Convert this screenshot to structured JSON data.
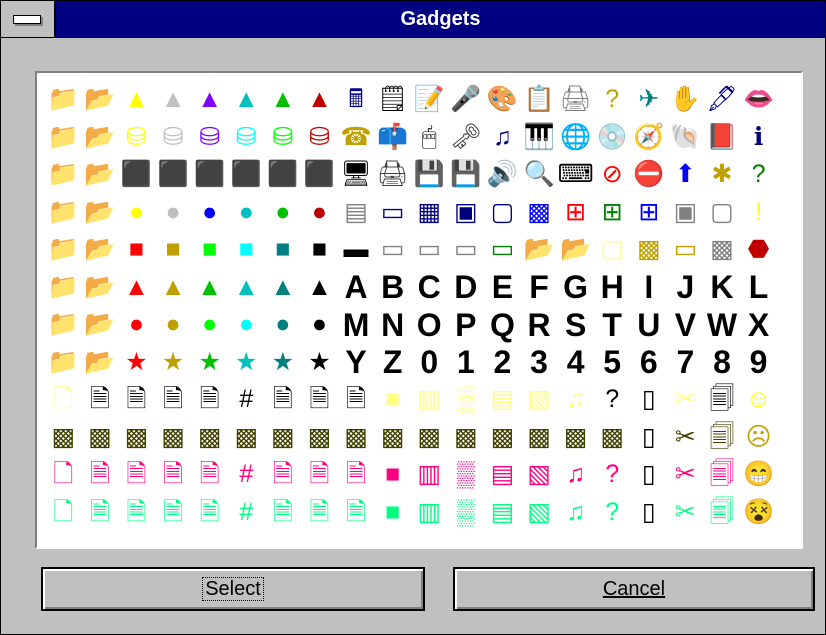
{
  "window": {
    "title": "Gadgets"
  },
  "buttons": {
    "select_label": "Select",
    "cancel_label": "Cancel"
  },
  "grid": {
    "rows": [
      [
        {
          "g": "📁",
          "c": "#e0006a"
        },
        {
          "g": "📂",
          "c": "#a00040"
        },
        {
          "g": "▲",
          "c": "#ffff00"
        },
        {
          "g": "▲",
          "c": "#c0c0c0"
        },
        {
          "g": "▲",
          "c": "#8000ff"
        },
        {
          "g": "▲",
          "c": "#00c0c0"
        },
        {
          "g": "▲",
          "c": "#00c000"
        },
        {
          "g": "▲",
          "c": "#c00000"
        },
        {
          "g": "🖩",
          "c": "#000080"
        },
        {
          "g": "🗒",
          "c": "#000000"
        },
        {
          "g": "📝",
          "c": "#000080"
        },
        {
          "g": "🎤",
          "c": "#000080"
        },
        {
          "g": "🎨",
          "c": "#a06000"
        },
        {
          "g": "📋",
          "c": "#008080"
        },
        {
          "g": "🖨",
          "c": "#808080"
        },
        {
          "g": "?",
          "c": "#c0a000"
        },
        {
          "g": "✈",
          "c": "#008080"
        },
        {
          "g": "✋",
          "c": "#008080"
        },
        {
          "g": "🖋",
          "c": "#000080"
        },
        {
          "g": "👄",
          "c": "#ff0000"
        }
      ],
      [
        {
          "g": "📁",
          "c": "#ffff00"
        },
        {
          "g": "📂",
          "c": "#c0a000"
        },
        {
          "g": "⛁",
          "c": "#ffff00"
        },
        {
          "g": "⛁",
          "c": "#c0c0c0"
        },
        {
          "g": "⛁",
          "c": "#8000ff"
        },
        {
          "g": "⛁",
          "c": "#00ffff"
        },
        {
          "g": "⛁",
          "c": "#00ff00"
        },
        {
          "g": "⛁",
          "c": "#c00000"
        },
        {
          "g": "☎",
          "c": "#c0a000"
        },
        {
          "g": "📫",
          "c": "#808080"
        },
        {
          "g": "🖱",
          "c": "#000000"
        },
        {
          "g": "🗝",
          "c": "#404040"
        },
        {
          "g": "♫",
          "c": "#000080"
        },
        {
          "g": "🎹",
          "c": "#000000"
        },
        {
          "g": "🌐",
          "c": "#008000"
        },
        {
          "g": "💿",
          "c": "#808080"
        },
        {
          "g": "🧭",
          "c": "#c0a000"
        },
        {
          "g": "🐚",
          "c": "#c0a000"
        },
        {
          "g": "📕",
          "c": "#c00000"
        },
        {
          "g": "ℹ",
          "c": "#000080"
        }
      ],
      [
        {
          "g": "📁",
          "c": "#ffff80"
        },
        {
          "g": "📂",
          "c": "#c0a000"
        },
        {
          "g": "⬛",
          "c": "#ffff00"
        },
        {
          "g": "⬛",
          "c": "#c0c0c0"
        },
        {
          "g": "⬛",
          "c": "#8000ff"
        },
        {
          "g": "⬛",
          "c": "#00ffff"
        },
        {
          "g": "⬛",
          "c": "#00ff00"
        },
        {
          "g": "⬛",
          "c": "#c00000"
        },
        {
          "g": "🖥",
          "c": "#000000"
        },
        {
          "g": "🖨",
          "c": "#404040"
        },
        {
          "g": "💾",
          "c": "#000080"
        },
        {
          "g": "💾",
          "c": "#000000"
        },
        {
          "g": "🔊",
          "c": "#000000"
        },
        {
          "g": "🔍",
          "c": "#000000"
        },
        {
          "g": "⌨",
          "c": "#000000"
        },
        {
          "g": "⊘",
          "c": "#ff0000"
        },
        {
          "g": "⛔",
          "c": "#ff0000"
        },
        {
          "g": "⬆",
          "c": "#0000ff"
        },
        {
          "g": "✱",
          "c": "#c0a000"
        },
        {
          "g": "?",
          "c": "#008000"
        }
      ],
      [
        {
          "g": "📁",
          "c": "#80ff80"
        },
        {
          "g": "📂",
          "c": "#008000"
        },
        {
          "g": "●",
          "c": "#ffff00"
        },
        {
          "g": "●",
          "c": "#c0c0c0"
        },
        {
          "g": "●",
          "c": "#0000ff"
        },
        {
          "g": "●",
          "c": "#00c0c0"
        },
        {
          "g": "●",
          "c": "#00c000"
        },
        {
          "g": "●",
          "c": "#c00000"
        },
        {
          "g": "▤",
          "c": "#808080"
        },
        {
          "g": "▭",
          "c": "#000080"
        },
        {
          "g": "▦",
          "c": "#000080"
        },
        {
          "g": "▣",
          "c": "#000080"
        },
        {
          "g": "▢",
          "c": "#000080"
        },
        {
          "g": "▩",
          "c": "#0000ff"
        },
        {
          "g": "⊞",
          "c": "#ff0000"
        },
        {
          "g": "⊞",
          "c": "#008000"
        },
        {
          "g": "⊞",
          "c": "#0000ff"
        },
        {
          "g": "▣",
          "c": "#808080"
        },
        {
          "g": "▢",
          "c": "#808080"
        },
        {
          "g": "!",
          "c": "#ffff00"
        }
      ],
      [
        {
          "g": "📁",
          "c": "#80ffff"
        },
        {
          "g": "📂",
          "c": "#008080"
        },
        {
          "g": "■",
          "c": "#ff0000"
        },
        {
          "g": "■",
          "c": "#c0a000"
        },
        {
          "g": "■",
          "c": "#00ff00"
        },
        {
          "g": "■",
          "c": "#00ffff"
        },
        {
          "g": "■",
          "c": "#008080"
        },
        {
          "g": "■",
          "c": "#000000"
        },
        {
          "g": "▬",
          "c": "#000000"
        },
        {
          "g": "▭",
          "c": "#808080"
        },
        {
          "g": "▭",
          "c": "#808080"
        },
        {
          "g": "▭",
          "c": "#808080"
        },
        {
          "g": "▭",
          "c": "#008000"
        },
        {
          "g": "📂",
          "c": "#ffff00"
        },
        {
          "g": "📂",
          "c": "#ffff80"
        },
        {
          "g": "▢",
          "c": "#ffff80"
        },
        {
          "g": "▩",
          "c": "#c0a000"
        },
        {
          "g": "▭",
          "c": "#c0a000"
        },
        {
          "g": "▩",
          "c": "#808080"
        },
        {
          "g": "⬣",
          "c": "#c00000"
        }
      ],
      [
        {
          "g": "📁",
          "c": "#8000ff"
        },
        {
          "g": "📂",
          "c": "#400080"
        },
        {
          "g": "▲",
          "c": "#ff0000"
        },
        {
          "g": "▲",
          "c": "#c0a000"
        },
        {
          "g": "▲",
          "c": "#00c000"
        },
        {
          "g": "▲",
          "c": "#00c0c0"
        },
        {
          "g": "▲",
          "c": "#008080"
        },
        {
          "g": "▲",
          "c": "#000000"
        },
        {
          "g": "A",
          "c": "#000000",
          "t": "letter"
        },
        {
          "g": "B",
          "c": "#000000",
          "t": "letter"
        },
        {
          "g": "C",
          "c": "#000000",
          "t": "letter"
        },
        {
          "g": "D",
          "c": "#000000",
          "t": "letter"
        },
        {
          "g": "E",
          "c": "#000000",
          "t": "letter"
        },
        {
          "g": "F",
          "c": "#000000",
          "t": "letter"
        },
        {
          "g": "G",
          "c": "#000000",
          "t": "letter"
        },
        {
          "g": "H",
          "c": "#000000",
          "t": "letter"
        },
        {
          "g": "I",
          "c": "#000000",
          "t": "letter"
        },
        {
          "g": "J",
          "c": "#000000",
          "t": "letter"
        },
        {
          "g": "K",
          "c": "#000000",
          "t": "letter"
        },
        {
          "g": "L",
          "c": "#000000",
          "t": "letter"
        }
      ],
      [
        {
          "g": "📁",
          "c": "#ffffff"
        },
        {
          "g": "📂",
          "c": "#ffffff"
        },
        {
          "g": "●",
          "c": "#ff0000"
        },
        {
          "g": "●",
          "c": "#c0a000"
        },
        {
          "g": "●",
          "c": "#00ff00"
        },
        {
          "g": "●",
          "c": "#00ffff"
        },
        {
          "g": "●",
          "c": "#008080"
        },
        {
          "g": "●",
          "c": "#000000"
        },
        {
          "g": "M",
          "c": "#000000",
          "t": "letter"
        },
        {
          "g": "N",
          "c": "#000000",
          "t": "letter"
        },
        {
          "g": "O",
          "c": "#000000",
          "t": "letter"
        },
        {
          "g": "P",
          "c": "#000000",
          "t": "letter"
        },
        {
          "g": "Q",
          "c": "#000000",
          "t": "letter"
        },
        {
          "g": "R",
          "c": "#000000",
          "t": "letter"
        },
        {
          "g": "S",
          "c": "#000000",
          "t": "letter"
        },
        {
          "g": "T",
          "c": "#000000",
          "t": "letter"
        },
        {
          "g": "U",
          "c": "#000000",
          "t": "letter"
        },
        {
          "g": "V",
          "c": "#000000",
          "t": "letter"
        },
        {
          "g": "W",
          "c": "#000000",
          "t": "letter"
        },
        {
          "g": "X",
          "c": "#000000",
          "t": "letter"
        }
      ],
      [
        {
          "g": "📁",
          "c": "#808080"
        },
        {
          "g": "📂",
          "c": "#808080"
        },
        {
          "g": "★",
          "c": "#ff0000"
        },
        {
          "g": "★",
          "c": "#c0a000"
        },
        {
          "g": "★",
          "c": "#00c000"
        },
        {
          "g": "★",
          "c": "#00c0c0"
        },
        {
          "g": "★",
          "c": "#008080"
        },
        {
          "g": "★",
          "c": "#000000"
        },
        {
          "g": "Y",
          "c": "#000000",
          "t": "letter"
        },
        {
          "g": "Z",
          "c": "#000000",
          "t": "letter"
        },
        {
          "g": "0",
          "c": "#000000",
          "t": "letter"
        },
        {
          "g": "1",
          "c": "#000000",
          "t": "letter"
        },
        {
          "g": "2",
          "c": "#000000",
          "t": "letter"
        },
        {
          "g": "3",
          "c": "#000000",
          "t": "letter"
        },
        {
          "g": "4",
          "c": "#000000",
          "t": "letter"
        },
        {
          "g": "5",
          "c": "#000000",
          "t": "letter"
        },
        {
          "g": "6",
          "c": "#000000",
          "t": "letter"
        },
        {
          "g": "7",
          "c": "#000000",
          "t": "letter"
        },
        {
          "g": "8",
          "c": "#000000",
          "t": "letter"
        },
        {
          "g": "9",
          "c": "#000000",
          "t": "letter"
        }
      ],
      [
        {
          "g": "🗋",
          "c": "#ffff80"
        },
        {
          "g": "🗎",
          "c": "#000000"
        },
        {
          "g": "🗎",
          "c": "#000000"
        },
        {
          "g": "🗎",
          "c": "#000000"
        },
        {
          "g": "🗎",
          "c": "#000000"
        },
        {
          "g": "#",
          "c": "#000000"
        },
        {
          "g": "🗎",
          "c": "#000000"
        },
        {
          "g": "🗎",
          "c": "#000000"
        },
        {
          "g": "🗎",
          "c": "#000000"
        },
        {
          "g": "■",
          "c": "#ffff80"
        },
        {
          "g": "▥",
          "c": "#ffff80"
        },
        {
          "g": "▒",
          "c": "#ffff80"
        },
        {
          "g": "▤",
          "c": "#ffff80"
        },
        {
          "g": "▧",
          "c": "#ffff80"
        },
        {
          "g": "♫",
          "c": "#ffff80"
        },
        {
          "g": "?",
          "c": "#000000"
        },
        {
          "g": "▯",
          "c": "#000000"
        },
        {
          "g": "✂",
          "c": "#ffff80"
        },
        {
          "g": "🗐",
          "c": "#000000"
        },
        {
          "g": "☺",
          "c": "#ffff00"
        }
      ],
      [
        {
          "g": "▩",
          "c": "#404000"
        },
        {
          "g": "▩",
          "c": "#404000"
        },
        {
          "g": "▩",
          "c": "#404000"
        },
        {
          "g": "▩",
          "c": "#404000"
        },
        {
          "g": "▩",
          "c": "#404000"
        },
        {
          "g": "▩",
          "c": "#404000"
        },
        {
          "g": "▩",
          "c": "#404000"
        },
        {
          "g": "▩",
          "c": "#404000"
        },
        {
          "g": "▩",
          "c": "#404000"
        },
        {
          "g": "▩",
          "c": "#404000"
        },
        {
          "g": "▩",
          "c": "#404000"
        },
        {
          "g": "▩",
          "c": "#404000"
        },
        {
          "g": "▩",
          "c": "#404000"
        },
        {
          "g": "▩",
          "c": "#404000"
        },
        {
          "g": "▩",
          "c": "#404000"
        },
        {
          "g": "▩",
          "c": "#404000"
        },
        {
          "g": "▯",
          "c": "#000000"
        },
        {
          "g": "✂",
          "c": "#404000"
        },
        {
          "g": "🗐",
          "c": "#404000"
        },
        {
          "g": "☹",
          "c": "#c0a000"
        }
      ],
      [
        {
          "g": "🗋",
          "c": "#ff0080"
        },
        {
          "g": "🗎",
          "c": "#ff0080"
        },
        {
          "g": "🗎",
          "c": "#ff0080"
        },
        {
          "g": "🗎",
          "c": "#ff0080"
        },
        {
          "g": "🗎",
          "c": "#ff0080"
        },
        {
          "g": "#",
          "c": "#ff0080"
        },
        {
          "g": "🗎",
          "c": "#ff0080"
        },
        {
          "g": "🗎",
          "c": "#ff0080"
        },
        {
          "g": "🗎",
          "c": "#ff0080"
        },
        {
          "g": "■",
          "c": "#ff0080"
        },
        {
          "g": "▥",
          "c": "#ff0080"
        },
        {
          "g": "▒",
          "c": "#ff0080"
        },
        {
          "g": "▤",
          "c": "#ff0080"
        },
        {
          "g": "▧",
          "c": "#ff0080"
        },
        {
          "g": "♫",
          "c": "#ff0080"
        },
        {
          "g": "?",
          "c": "#ff0080"
        },
        {
          "g": "▯",
          "c": "#000000"
        },
        {
          "g": "✂",
          "c": "#ff0080"
        },
        {
          "g": "🗐",
          "c": "#ff0080"
        },
        {
          "g": "😁",
          "c": "#ffff00"
        }
      ],
      [
        {
          "g": "🗋",
          "c": "#00ff80"
        },
        {
          "g": "🗎",
          "c": "#00ff80"
        },
        {
          "g": "🗎",
          "c": "#00ff80"
        },
        {
          "g": "🗎",
          "c": "#00ff80"
        },
        {
          "g": "🗎",
          "c": "#00ff80"
        },
        {
          "g": "#",
          "c": "#00ff80"
        },
        {
          "g": "🗎",
          "c": "#00ff80"
        },
        {
          "g": "🗎",
          "c": "#00ff80"
        },
        {
          "g": "🗎",
          "c": "#00ff80"
        },
        {
          "g": "■",
          "c": "#00ff80"
        },
        {
          "g": "▥",
          "c": "#00ff80"
        },
        {
          "g": "▒",
          "c": "#00ff80"
        },
        {
          "g": "▤",
          "c": "#00ff80"
        },
        {
          "g": "▧",
          "c": "#00ff80"
        },
        {
          "g": "♫",
          "c": "#00ff80"
        },
        {
          "g": "?",
          "c": "#00ff80"
        },
        {
          "g": "▯",
          "c": "#000000"
        },
        {
          "g": "✂",
          "c": "#00ff80"
        },
        {
          "g": "🗐",
          "c": "#00ff80"
        },
        {
          "g": "😵",
          "c": "#ffff00"
        }
      ]
    ]
  }
}
